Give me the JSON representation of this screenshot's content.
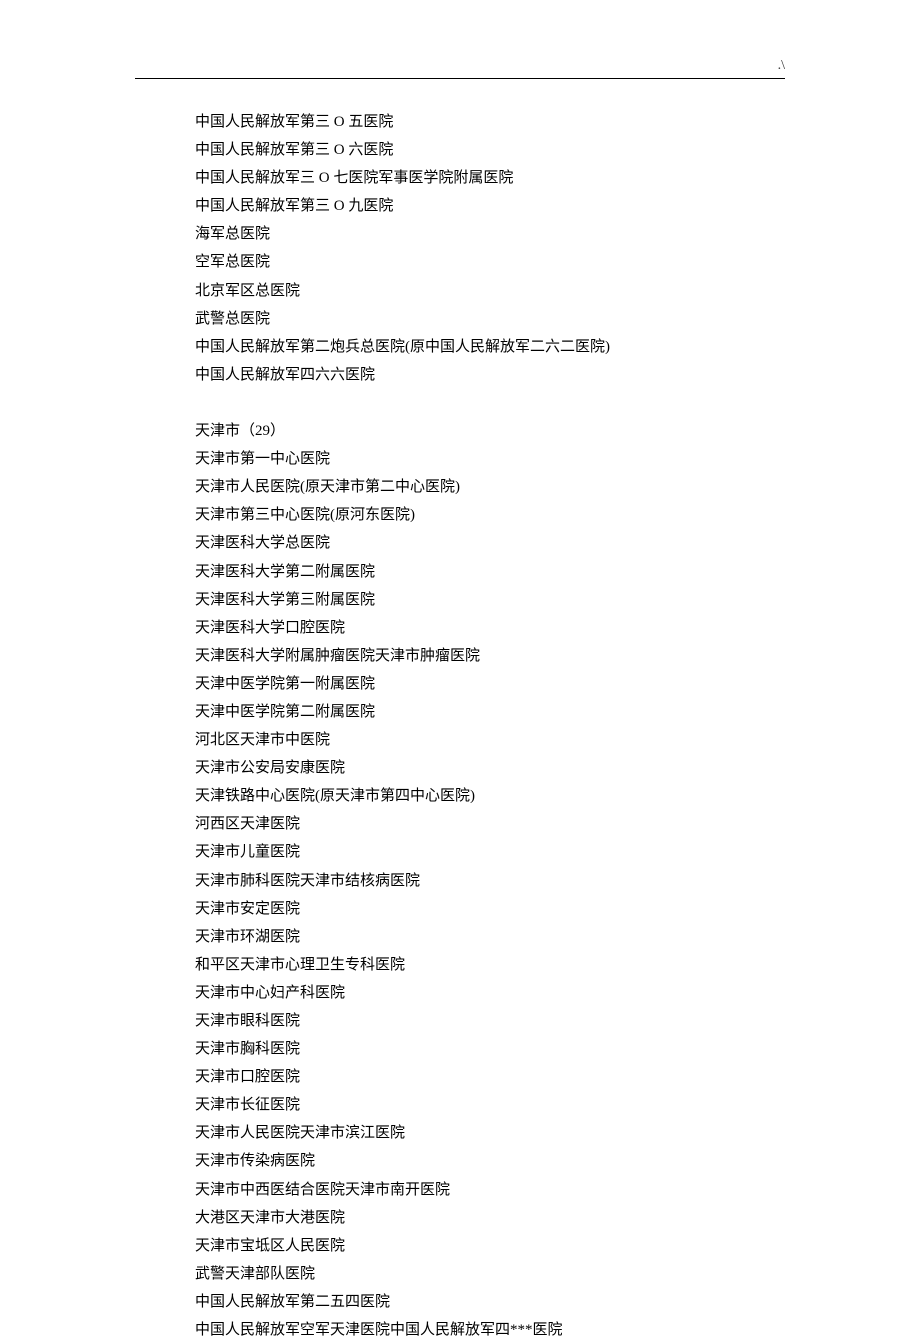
{
  "corner": ".\\",
  "section1": {
    "lines": [
      "中国人民解放军第三 O 五医院",
      "中国人民解放军第三 O 六医院",
      "中国人民解放军三 O 七医院军事医学院附属医院",
      "中国人民解放军第三 O 九医院",
      "海军总医院",
      "空军总医院",
      "北京军区总医院",
      "武警总医院",
      "中国人民解放军第二炮兵总医院(原中国人民解放军二六二医院)",
      "中国人民解放军四六六医院"
    ]
  },
  "section2": {
    "header": "天津市（29）",
    "lines": [
      "天津市第一中心医院",
      "天津市人民医院(原天津市第二中心医院)",
      "天津市第三中心医院(原河东医院)",
      "天津医科大学总医院",
      "天津医科大学第二附属医院",
      "天津医科大学第三附属医院",
      "天津医科大学口腔医院",
      "天津医科大学附属肿瘤医院天津市肿瘤医院",
      "天津中医学院第一附属医院",
      "天津中医学院第二附属医院",
      "河北区天津市中医院",
      "天津市公安局安康医院",
      "天津铁路中心医院(原天津市第四中心医院)",
      "河西区天津医院",
      "天津市儿童医院",
      "天津市肺科医院天津市结核病医院",
      "天津市安定医院",
      "天津市环湖医院",
      "和平区天津市心理卫生专科医院",
      "天津市中心妇产科医院",
      "天津市眼科医院",
      "天津市胸科医院",
      "天津市口腔医院",
      "天津市长征医院",
      "天津市人民医院天津市滨江医院",
      "天津市传染病医院",
      "天津市中西医结合医院天津市南开医院",
      "大港区天津市大港医院",
      "天津市宝坻区人民医院",
      "武警天津部队医院",
      "中国人民解放军第二五四医院",
      "中国人民解放军空军天津医院中国人民解放军四***医院"
    ]
  }
}
